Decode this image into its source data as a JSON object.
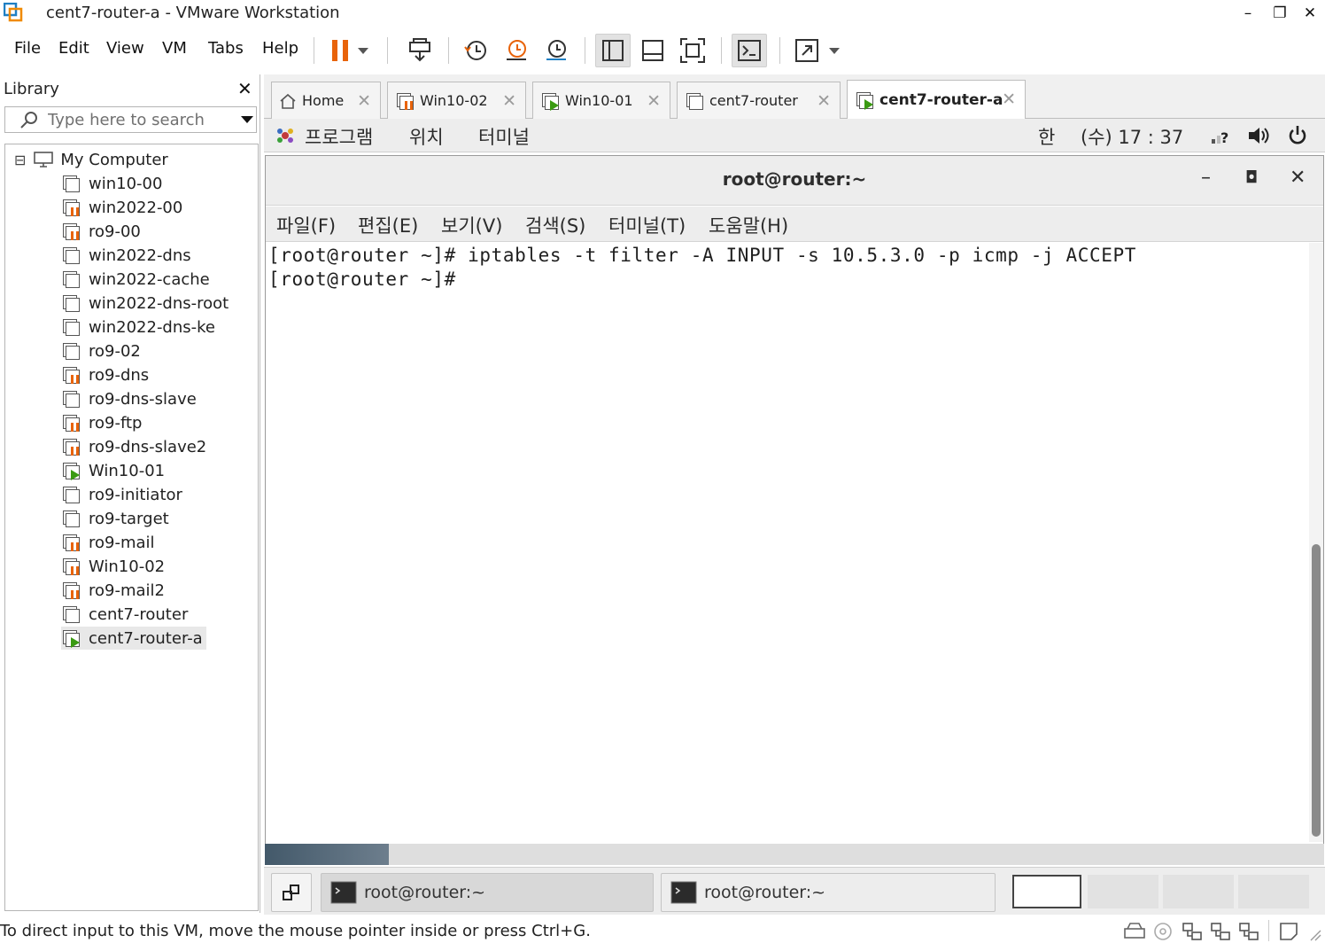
{
  "window": {
    "title": "cent7-router-a - VMware Workstation",
    "minimize": "–",
    "maximize": "❐",
    "close": "✕"
  },
  "menu": [
    "File",
    "Edit",
    "View",
    "VM",
    "Tabs",
    "Help"
  ],
  "toolbar": {
    "icons": [
      "pause-icon",
      "dropdown-icon",
      "send-ctrl-alt-del-icon",
      "snapshot-icon",
      "revert-snapshot-icon",
      "snapshot-manager-icon",
      "show-library-icon",
      "thumbnail-bar-icon",
      "full-screen-icon",
      "console-view-icon",
      "stretch-guest-icon"
    ],
    "accent": "#e8630a"
  },
  "library": {
    "title": "Library",
    "close": "✕",
    "search_placeholder": "Type here to search",
    "root": "My Computer",
    "root_toggle": "⊟",
    "items": [
      {
        "label": "win10-00",
        "state": "off"
      },
      {
        "label": "win2022-00",
        "state": "paused"
      },
      {
        "label": "ro9-00",
        "state": "paused"
      },
      {
        "label": "win2022-dns",
        "state": "off"
      },
      {
        "label": "win2022-cache",
        "state": "off"
      },
      {
        "label": "win2022-dns-root",
        "state": "off"
      },
      {
        "label": "win2022-dns-ke",
        "state": "off"
      },
      {
        "label": "ro9-02",
        "state": "off"
      },
      {
        "label": "ro9-dns",
        "state": "paused"
      },
      {
        "label": "ro9-dns-slave",
        "state": "off"
      },
      {
        "label": "ro9-ftp",
        "state": "paused"
      },
      {
        "label": "ro9-dns-slave2",
        "state": "paused"
      },
      {
        "label": "Win10-01",
        "state": "running"
      },
      {
        "label": "ro9-initiator",
        "state": "off"
      },
      {
        "label": "ro9-target",
        "state": "off"
      },
      {
        "label": "ro9-mail",
        "state": "paused"
      },
      {
        "label": "Win10-02",
        "state": "paused"
      },
      {
        "label": "ro9-mail2",
        "state": "paused"
      },
      {
        "label": "cent7-router",
        "state": "off"
      },
      {
        "label": "cent7-router-a",
        "state": "running",
        "selected": true
      }
    ]
  },
  "tabs": [
    {
      "label": "Home",
      "icon": "home-icon",
      "state": "home"
    },
    {
      "label": "Win10-02",
      "icon": "vm-paused-icon",
      "state": "paused"
    },
    {
      "label": "Win10-01",
      "icon": "vm-running-icon",
      "state": "running"
    },
    {
      "label": "cent7-router",
      "icon": "vm-off-icon",
      "state": "off"
    },
    {
      "label": "cent7-router-a",
      "icon": "vm-running-icon",
      "state": "running",
      "active": true
    }
  ],
  "tab_close": "✕",
  "guest_panel": {
    "applications": "프로그램",
    "places": "위치",
    "terminal": "터미널",
    "ime": "한",
    "clock": "(수) 17 : 37"
  },
  "terminal": {
    "title": "root@router:~",
    "min": "–",
    "max": "◘",
    "close": "✕",
    "menu": [
      "파일(F)",
      "편집(E)",
      "보기(V)",
      "검색(S)",
      "터미널(T)",
      "도움말(H)"
    ],
    "lines": [
      "[root@router ~]# iptables -t filter -A INPUT -s 10.5.3.0 -p icmp -j ACCEPT",
      "[root@router ~]#"
    ]
  },
  "taskbar": {
    "windows": [
      "root@router:~",
      "root@router:~"
    ]
  },
  "status": {
    "text": "To direct input to this VM, move the mouse pointer inside or press Ctrl+G."
  }
}
